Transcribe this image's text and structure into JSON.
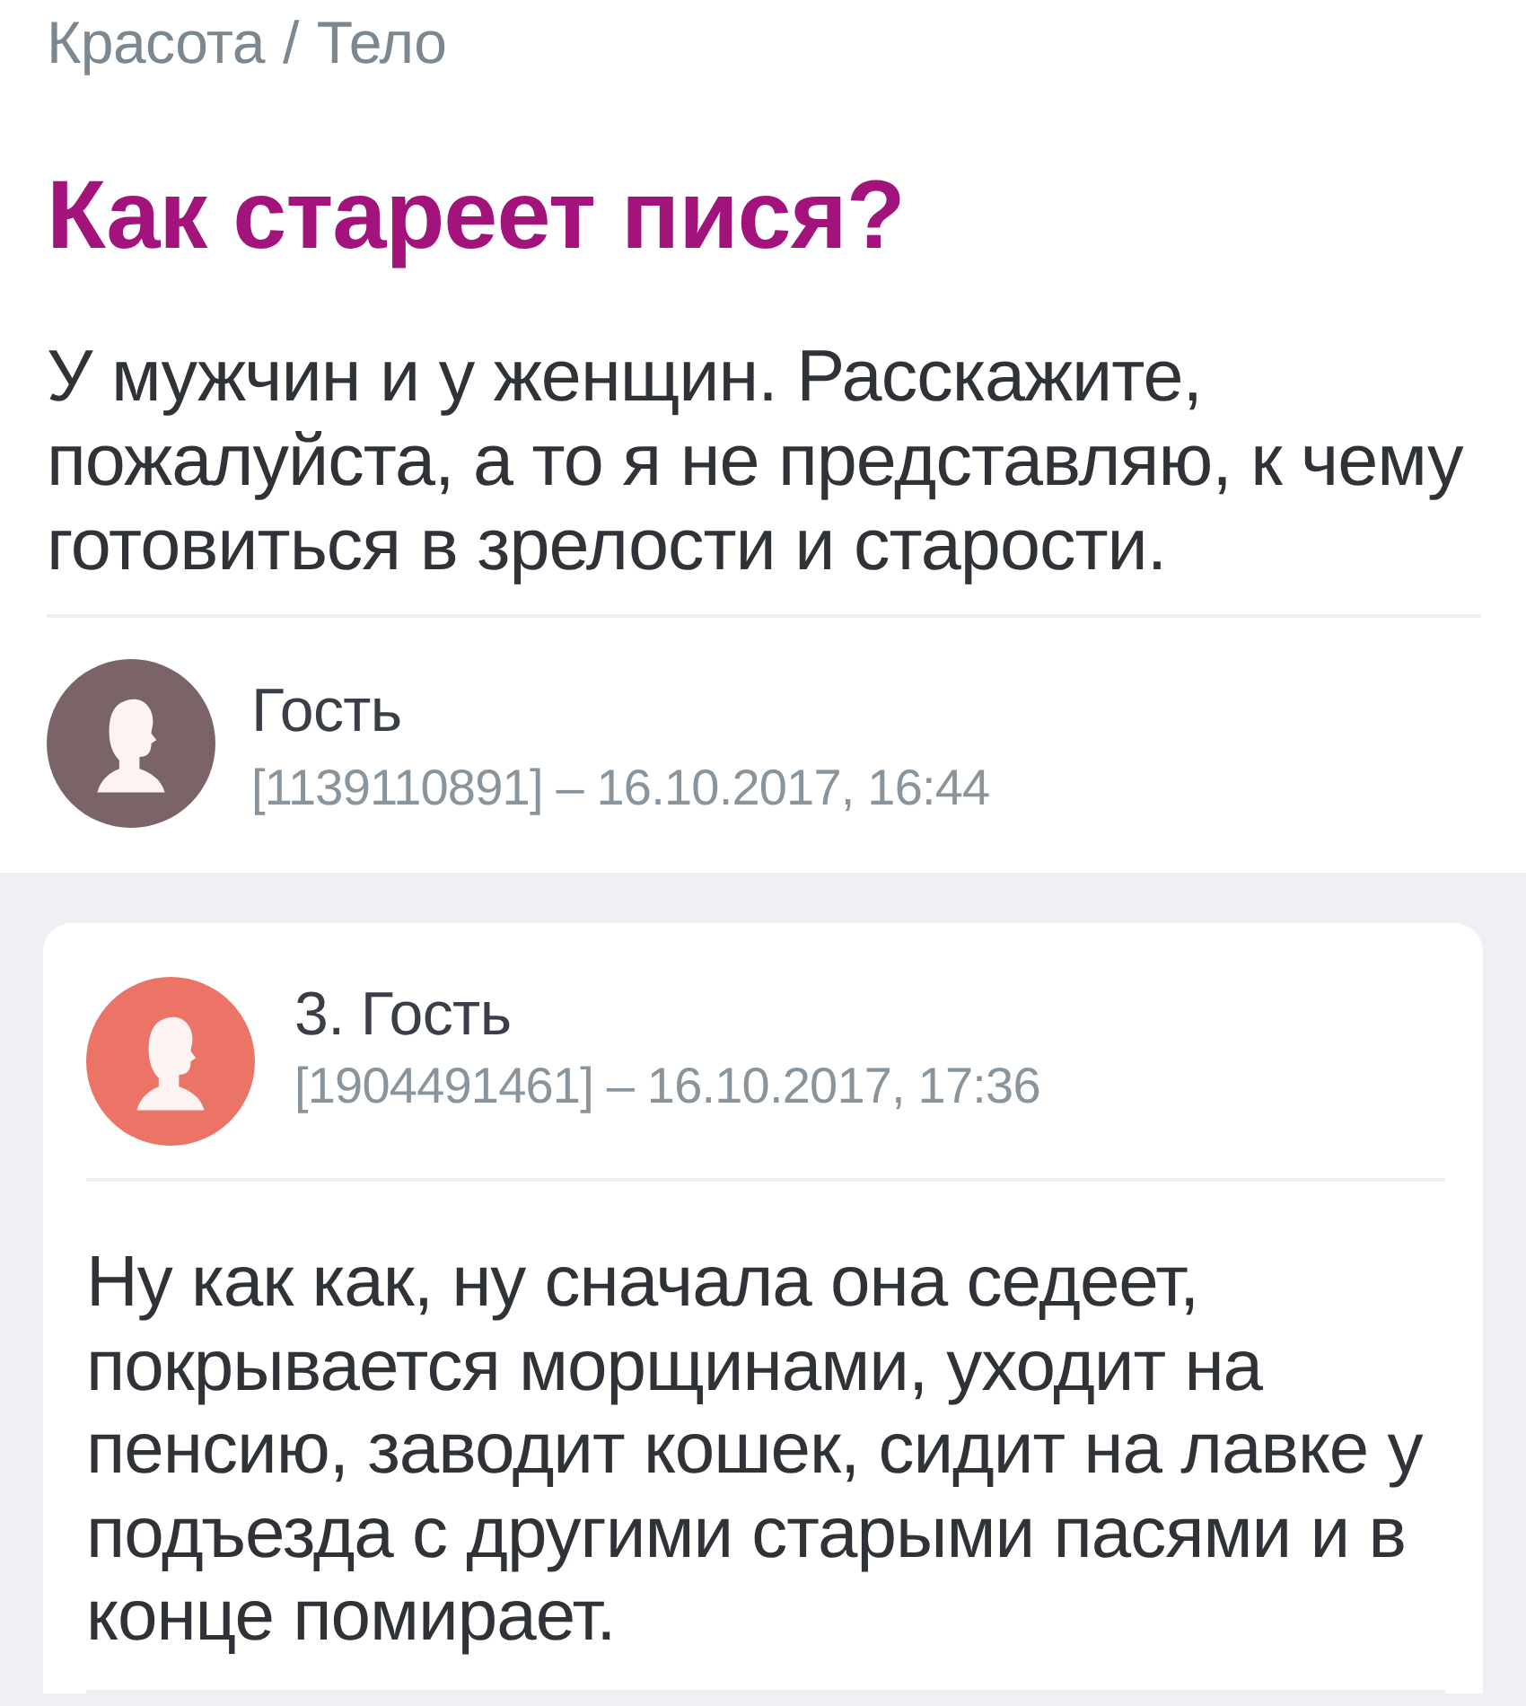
{
  "breadcrumb": {
    "items": [
      "Красота",
      "Тело"
    ],
    "separator": "/"
  },
  "question": {
    "title": "Как стареет пися?",
    "text": "У мужчин и у женщин. Расскажите, пожалуйста, а то я не представляю, к чему готовиться в зрелости и старости.",
    "author": {
      "name": "Гость",
      "meta": "[1139110891] – 16.10.2017, 16:44",
      "color": "#7b6468"
    }
  },
  "answers": [
    {
      "author": "3. Гость",
      "meta": "[1904491461] – 16.10.2017, 17:36",
      "color": "#ec7467",
      "text": "Ну как как, ну сначала она седеет, покрывается морщинами, уходит на пенсию, заводит кошек, сидит на лавке у подъезда с другими старыми пасями и в конце помирает."
    }
  ]
}
